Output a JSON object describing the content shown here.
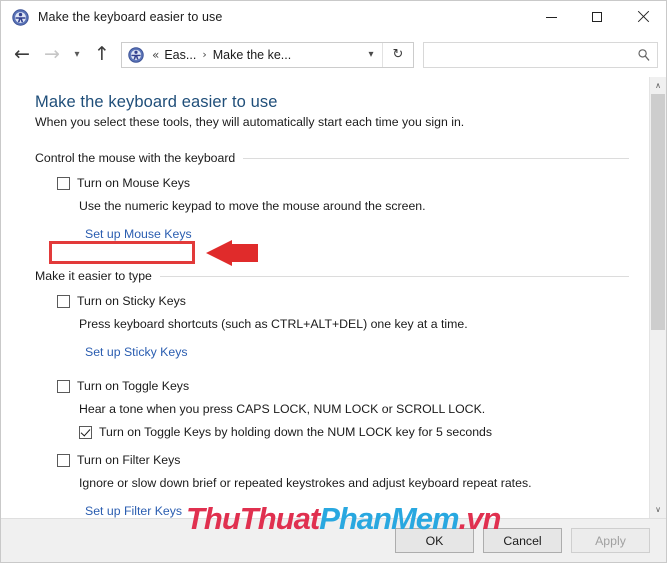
{
  "window": {
    "title": "Make the keyboard easier to use",
    "icon": "ease-of-access-icon",
    "minimize_label": "Minimize",
    "maximize_label": "Maximize",
    "close_label": "Close"
  },
  "navbar": {
    "back_label": "Back",
    "forward_label": "Forward",
    "recent_label": "Recent locations",
    "up_label": "Up one level",
    "breadcrumb": {
      "leading": "«",
      "items": [
        "Eas...",
        "Make the ke..."
      ],
      "separator": "›"
    },
    "dropdown_label": "Previous locations",
    "refresh_label": "Refresh",
    "search": {
      "value": "",
      "placeholder": "",
      "icon": "search-icon"
    }
  },
  "page": {
    "title": "Make the keyboard easier to use",
    "subtitle": "When you select these tools, they will automatically start each time you sign in.",
    "groups": [
      {
        "heading": "Control the mouse with the keyboard",
        "checkbox": {
          "label": "Turn on Mouse Keys",
          "checked": false
        },
        "description": "Use the numeric keypad to move the mouse around the screen.",
        "link": "Set up Mouse Keys"
      },
      {
        "heading": "Make it easier to type",
        "items": [
          {
            "checkbox": {
              "label": "Turn on Sticky Keys",
              "checked": false
            },
            "description": "Press keyboard shortcuts (such as CTRL+ALT+DEL) one key at a time.",
            "link": "Set up Sticky Keys"
          },
          {
            "checkbox": {
              "label": "Turn on Toggle Keys",
              "checked": false
            },
            "description": "Hear a tone when you press CAPS LOCK, NUM LOCK or SCROLL LOCK.",
            "sub_checkbox": {
              "label": "Turn on Toggle Keys by holding down the NUM LOCK key for 5 seconds",
              "checked": true
            }
          },
          {
            "checkbox": {
              "label": "Turn on Filter Keys",
              "checked": false
            },
            "description": "Ignore or slow down brief or repeated keystrokes and adjust keyboard repeat rates.",
            "link": "Set up Filter Keys"
          }
        ]
      }
    ]
  },
  "annotation": {
    "highlight_target": "Turn on Mouse Keys",
    "box_color": "#e23a3a",
    "arrow_color": "#e02b2b",
    "arrow_direction": "left"
  },
  "scrollbar": {
    "up_glyph": "∧",
    "down_glyph": "∨"
  },
  "buttons": {
    "ok": "OK",
    "cancel": "Cancel",
    "apply": "Apply",
    "apply_disabled": true
  },
  "watermark": {
    "part1": "ThuThuat",
    "part2": "PhanMem",
    "part3": ".vn",
    "color1": "#e0304f",
    "color2": "#29a8e0",
    "color3": "#e0304f"
  }
}
